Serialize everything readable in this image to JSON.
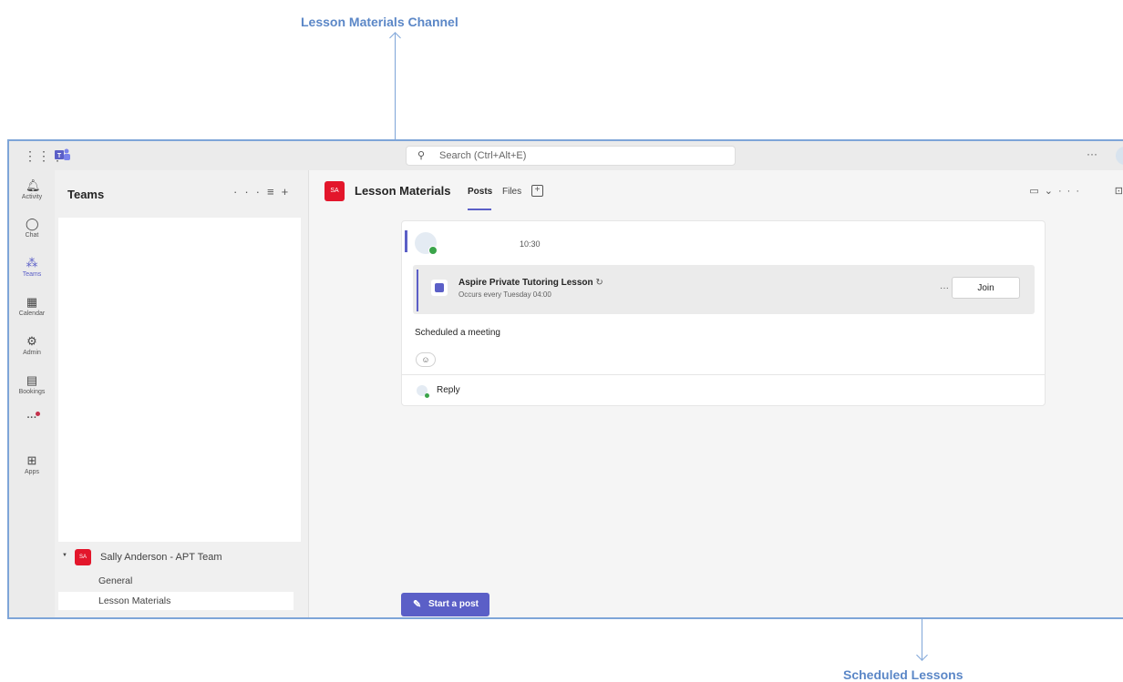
{
  "annotations": {
    "top_label": "Lesson Materials Channel",
    "bottom_label": "Scheduled Lessons"
  },
  "topbar": {
    "search_placeholder": "Search (Ctrl+Alt+E)",
    "more": "···"
  },
  "rail": {
    "items": [
      {
        "label": "Activity",
        "icon": "bell-icon"
      },
      {
        "label": "Chat",
        "icon": "chat-icon"
      },
      {
        "label": "Teams",
        "icon": "teams-icon"
      },
      {
        "label": "Calendar",
        "icon": "calendar-icon"
      },
      {
        "label": "Admin",
        "icon": "admin-icon"
      },
      {
        "label": "Bookings",
        "icon": "bookings-icon"
      },
      {
        "label": "···",
        "icon": "more-icon"
      },
      {
        "label": "Apps",
        "icon": "apps-icon"
      }
    ],
    "active": "Teams"
  },
  "teams_panel": {
    "title": "Teams",
    "team": {
      "badge": "SA",
      "name": "Sally Anderson - APT Team"
    },
    "channels": [
      "General",
      "Lesson Materials"
    ],
    "selected_channel": "Lesson Materials"
  },
  "channel_header": {
    "badge": "SA",
    "title": "Lesson Materials",
    "tabs": [
      "Posts",
      "Files"
    ],
    "active_tab": "Posts"
  },
  "post": {
    "time": "10:30",
    "meeting": {
      "title": "Aspire Private Tutoring Lesson",
      "recurrence": "Occurs every Tuesday 04:00",
      "join_label": "Join",
      "more": "···"
    },
    "text": "Scheduled a meeting",
    "reply_label": "Reply"
  },
  "compose": {
    "start_post_label": "Start a post"
  },
  "colors": {
    "accent": "#5b5fc7",
    "team_badge": "#e3162b",
    "presence": "#3aa44a",
    "annotation": "#5b87c7"
  }
}
